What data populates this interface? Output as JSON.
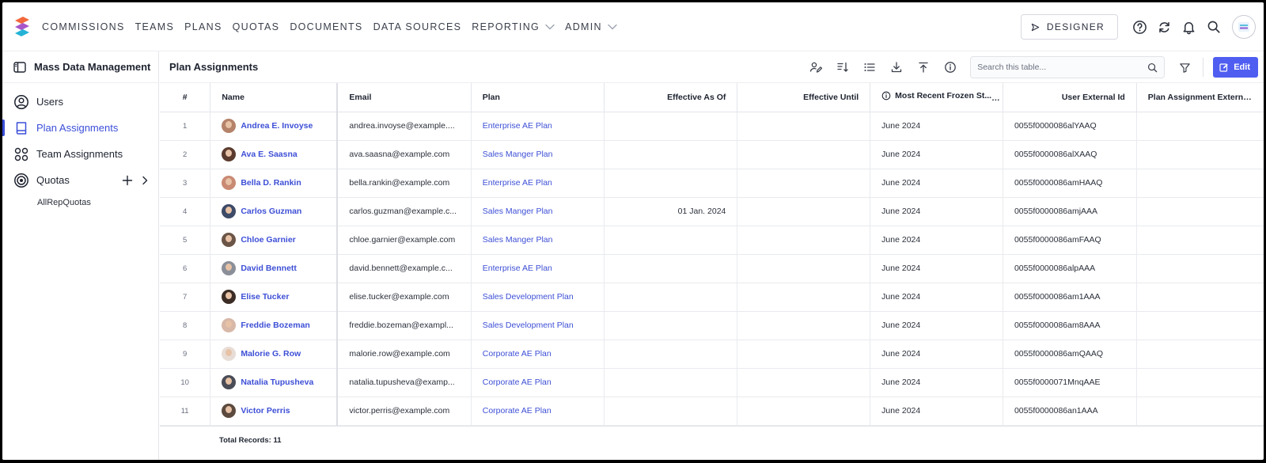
{
  "nav": {
    "items": [
      {
        "label": "COMMISSIONS",
        "dropdown": false
      },
      {
        "label": "TEAMS",
        "dropdown": false
      },
      {
        "label": "PLANS",
        "dropdown": false
      },
      {
        "label": "QUOTAS",
        "dropdown": false
      },
      {
        "label": "DOCUMENTS",
        "dropdown": false
      },
      {
        "label": "DATA SOURCES",
        "dropdown": false
      },
      {
        "label": "REPORTING",
        "dropdown": true
      },
      {
        "label": "ADMIN",
        "dropdown": true
      }
    ],
    "designer_label": "DESIGNER",
    "icons": [
      "help-icon",
      "refresh-icon",
      "bell-icon",
      "search-icon",
      "user-avatar"
    ]
  },
  "sidebar": {
    "title": "Mass Data Management",
    "items": [
      {
        "label": "Users",
        "icon": "user-circle-icon",
        "active": false
      },
      {
        "label": "Plan Assignments",
        "icon": "book-icon",
        "active": true
      },
      {
        "label": "Team Assignments",
        "icon": "team-icon",
        "active": false
      },
      {
        "label": "Quotas",
        "icon": "target-icon",
        "active": false
      }
    ],
    "subitems": [
      "AllRepQuotas"
    ]
  },
  "main": {
    "title": "Plan Assignments",
    "search_placeholder": "Search this table...",
    "edit_label": "Edit",
    "toolbar_icons": [
      "edit-columns-icon",
      "sort-icon",
      "list-icon",
      "download-icon",
      "upload-icon",
      "info-icon",
      "filter-icon"
    ]
  },
  "table": {
    "headers": [
      "#",
      "Name",
      "Email",
      "Plan",
      "Effective As Of",
      "Effective Until",
      "Most Recent Frozen St...",
      "User External Id",
      "Plan Assignment External Id"
    ],
    "rows": [
      {
        "num": "1",
        "name": "Andrea E. Invoyse",
        "email": "andrea.invoyse@example....",
        "plan": "Enterprise AE Plan",
        "as_of": "",
        "until": "",
        "frozen": "June 2024",
        "ext_id": "0055f0000086alYAAQ",
        "pa_ext_id": ""
      },
      {
        "num": "2",
        "name": "Ava E. Saasna",
        "email": "ava.saasna@example.com",
        "plan": "Sales Manger Plan",
        "as_of": "",
        "until": "",
        "frozen": "June 2024",
        "ext_id": "0055f0000086alXAAQ",
        "pa_ext_id": ""
      },
      {
        "num": "3",
        "name": "Bella D. Rankin",
        "email": "bella.rankin@example.com",
        "plan": "Enterprise AE Plan",
        "as_of": "",
        "until": "",
        "frozen": "June 2024",
        "ext_id": "0055f0000086amHAAQ",
        "pa_ext_id": ""
      },
      {
        "num": "4",
        "name": "Carlos Guzman",
        "email": "carlos.guzman@example.c...",
        "plan": "Sales Manger Plan",
        "as_of": "01 Jan. 2024",
        "until": "",
        "frozen": "June 2024",
        "ext_id": "0055f0000086amjAAA",
        "pa_ext_id": ""
      },
      {
        "num": "5",
        "name": "Chloe Garnier",
        "email": "chloe.garnier@example.com",
        "plan": "Sales Manger Plan",
        "as_of": "",
        "until": "",
        "frozen": "June 2024",
        "ext_id": "0055f0000086amFAAQ",
        "pa_ext_id": ""
      },
      {
        "num": "6",
        "name": "David Bennett",
        "email": "david.bennett@example.c...",
        "plan": "Enterprise AE Plan",
        "as_of": "",
        "until": "",
        "frozen": "June 2024",
        "ext_id": "0055f0000086alpAAA",
        "pa_ext_id": ""
      },
      {
        "num": "7",
        "name": "Elise Tucker",
        "email": "elise.tucker@example.com",
        "plan": "Sales Development Plan",
        "as_of": "",
        "until": "",
        "frozen": "June 2024",
        "ext_id": "0055f0000086am1AAA",
        "pa_ext_id": ""
      },
      {
        "num": "8",
        "name": "Freddie Bozeman",
        "email": "freddie.bozeman@exampl...",
        "plan": "Sales Development Plan",
        "as_of": "",
        "until": "",
        "frozen": "June 2024",
        "ext_id": "0055f0000086am8AAA",
        "pa_ext_id": ""
      },
      {
        "num": "9",
        "name": "Malorie G. Row",
        "email": "malorie.row@example.com",
        "plan": "Corporate AE Plan",
        "as_of": "",
        "until": "",
        "frozen": "June 2024",
        "ext_id": "0055f0000086amQAAQ",
        "pa_ext_id": ""
      },
      {
        "num": "10",
        "name": "Natalia Tupusheva",
        "email": "natalia.tupusheva@examp...",
        "plan": "Corporate AE Plan",
        "as_of": "",
        "until": "",
        "frozen": "June 2024",
        "ext_id": "0055f0000071MnqAAE",
        "pa_ext_id": ""
      },
      {
        "num": "11",
        "name": "Victor Perris",
        "email": "victor.perris@example.com",
        "plan": "Corporate AE Plan",
        "as_of": "",
        "until": "",
        "frozen": "June 2024",
        "ext_id": "0055f0000086an1AAA",
        "pa_ext_id": ""
      }
    ],
    "avatar_colors": [
      "#b5826a",
      "#5a3b2e",
      "#c98a74",
      "#3d4a68",
      "#6b5547",
      "#8a8f99",
      "#3b2c25",
      "#d8b8a8",
      "#e8ddd6",
      "#4a4d57",
      "#5c4a3e"
    ]
  },
  "footer": {
    "label": "Total Records:",
    "count": "11"
  },
  "colors": {
    "accent": "#3d4fd6",
    "edit_button": "#4f5ef0"
  }
}
